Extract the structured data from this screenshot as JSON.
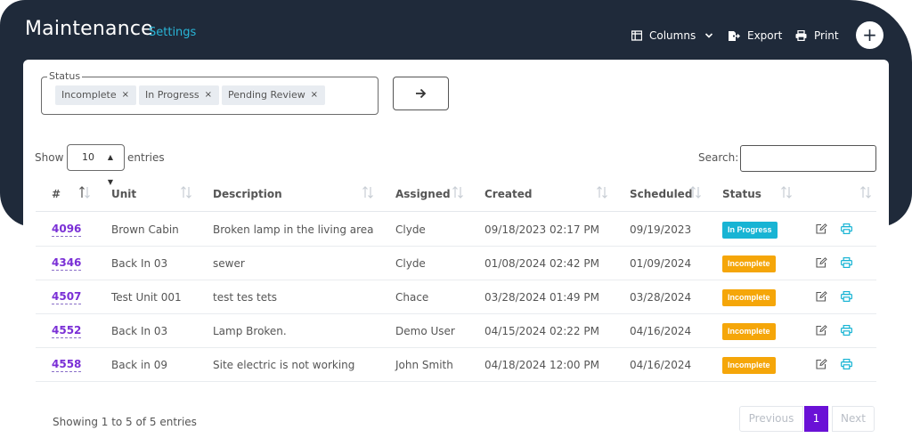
{
  "header": {
    "title": "Maintenance",
    "settings_label": "Settings",
    "columns_label": "Columns",
    "export_label": "Export",
    "print_label": "Print",
    "add_label": "+"
  },
  "filter": {
    "status_legend": "Status",
    "chips": [
      {
        "label": "Incomplete",
        "remove": "×"
      },
      {
        "label": "In Progress",
        "remove": "×"
      },
      {
        "label": "Pending Review",
        "remove": "×"
      }
    ]
  },
  "table_controls": {
    "show_label": "Show",
    "entries_value": "10",
    "entries_label": "entries",
    "search_label": "Search:",
    "search_value": ""
  },
  "columns": [
    "#",
    "Unit",
    "Description",
    "Assigned",
    "Created",
    "Scheduled",
    "Status"
  ],
  "rows": [
    {
      "id": "4096",
      "unit": "Brown Cabin",
      "description": "Broken lamp in the living area",
      "assigned": "Clyde",
      "created": "09/18/2023 02:17 PM",
      "scheduled": "09/19/2023",
      "status": "In Progress"
    },
    {
      "id": "4346",
      "unit": "Back In 03",
      "description": "sewer",
      "assigned": "Clyde",
      "created": "01/08/2024 02:42 PM",
      "scheduled": "01/09/2024",
      "status": "Incomplete"
    },
    {
      "id": "4507",
      "unit": "Test Unit 001",
      "description": "test tes tets",
      "assigned": "Chace",
      "created": "03/28/2024 01:49 PM",
      "scheduled": "03/28/2024",
      "status": "Incomplete"
    },
    {
      "id": "4552",
      "unit": "Back In 03",
      "description": "Lamp Broken.",
      "assigned": "Demo User",
      "created": "04/15/2024 02:22 PM",
      "scheduled": "04/16/2024",
      "status": "Incomplete"
    },
    {
      "id": "4558",
      "unit": "Back in 09",
      "description": "Site electric is not working",
      "assigned": "John Smith",
      "created": "04/18/2024 12:00 PM",
      "scheduled": "04/16/2024",
      "status": "Incomplete"
    }
  ],
  "footer": {
    "showing": "Showing 1 to 5 of 5 entries",
    "previous": "Previous",
    "page": "1",
    "next": "Next"
  },
  "colors": {
    "header_bg": "#1f2a3a",
    "accent_link": "#29b6d8",
    "id_link": "#7a2fd6",
    "in_progress": "#18b4d4",
    "incomplete": "#f5a609",
    "active_page": "#6a11d6"
  },
  "icons": {
    "columns": "columns-icon",
    "chevron": "chevron-down-icon",
    "export": "export-icon",
    "print": "printer-icon",
    "add": "plus-icon",
    "go": "arrow-right-icon",
    "sort": "sort-icon",
    "edit": "edit-icon",
    "row_print": "printer-icon"
  }
}
